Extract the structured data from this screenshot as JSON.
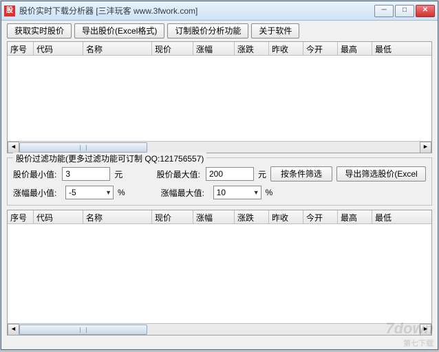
{
  "window": {
    "icon_text": "股",
    "title": "股价实时下载分析器 [三沣玩客 www.3fwork.com]"
  },
  "toolbar": {
    "btn_fetch": "获取实时股价",
    "btn_export": "导出股价(Excel格式)",
    "btn_customize": "订制股价分析功能",
    "btn_about": "关于软件"
  },
  "columns": {
    "c0": "序号",
    "c1": "代码",
    "c2": "名称",
    "c3": "现价",
    "c4": "涨幅",
    "c5": "涨跌",
    "c6": "昨收",
    "c7": "今开",
    "c8": "最高",
    "c9": "最低"
  },
  "filter": {
    "legend": "股价过滤功能(更多过滤功能可订制 QQ:121756557)",
    "price_min_label": "股价最小值:",
    "price_min_value": "3",
    "price_max_label": "股价最大值:",
    "price_max_value": "200",
    "unit_yuan": "元",
    "pct_min_label": "涨幅最小值:",
    "pct_min_value": "-5",
    "pct_max_label": "涨幅最大值:",
    "pct_max_value": "10",
    "unit_pct": "%",
    "btn_filter": "按条件筛选",
    "btn_export_filtered": "导出筛选股价(Excel格"
  },
  "watermark": {
    "main": "7down",
    "sub": "第七下载"
  }
}
